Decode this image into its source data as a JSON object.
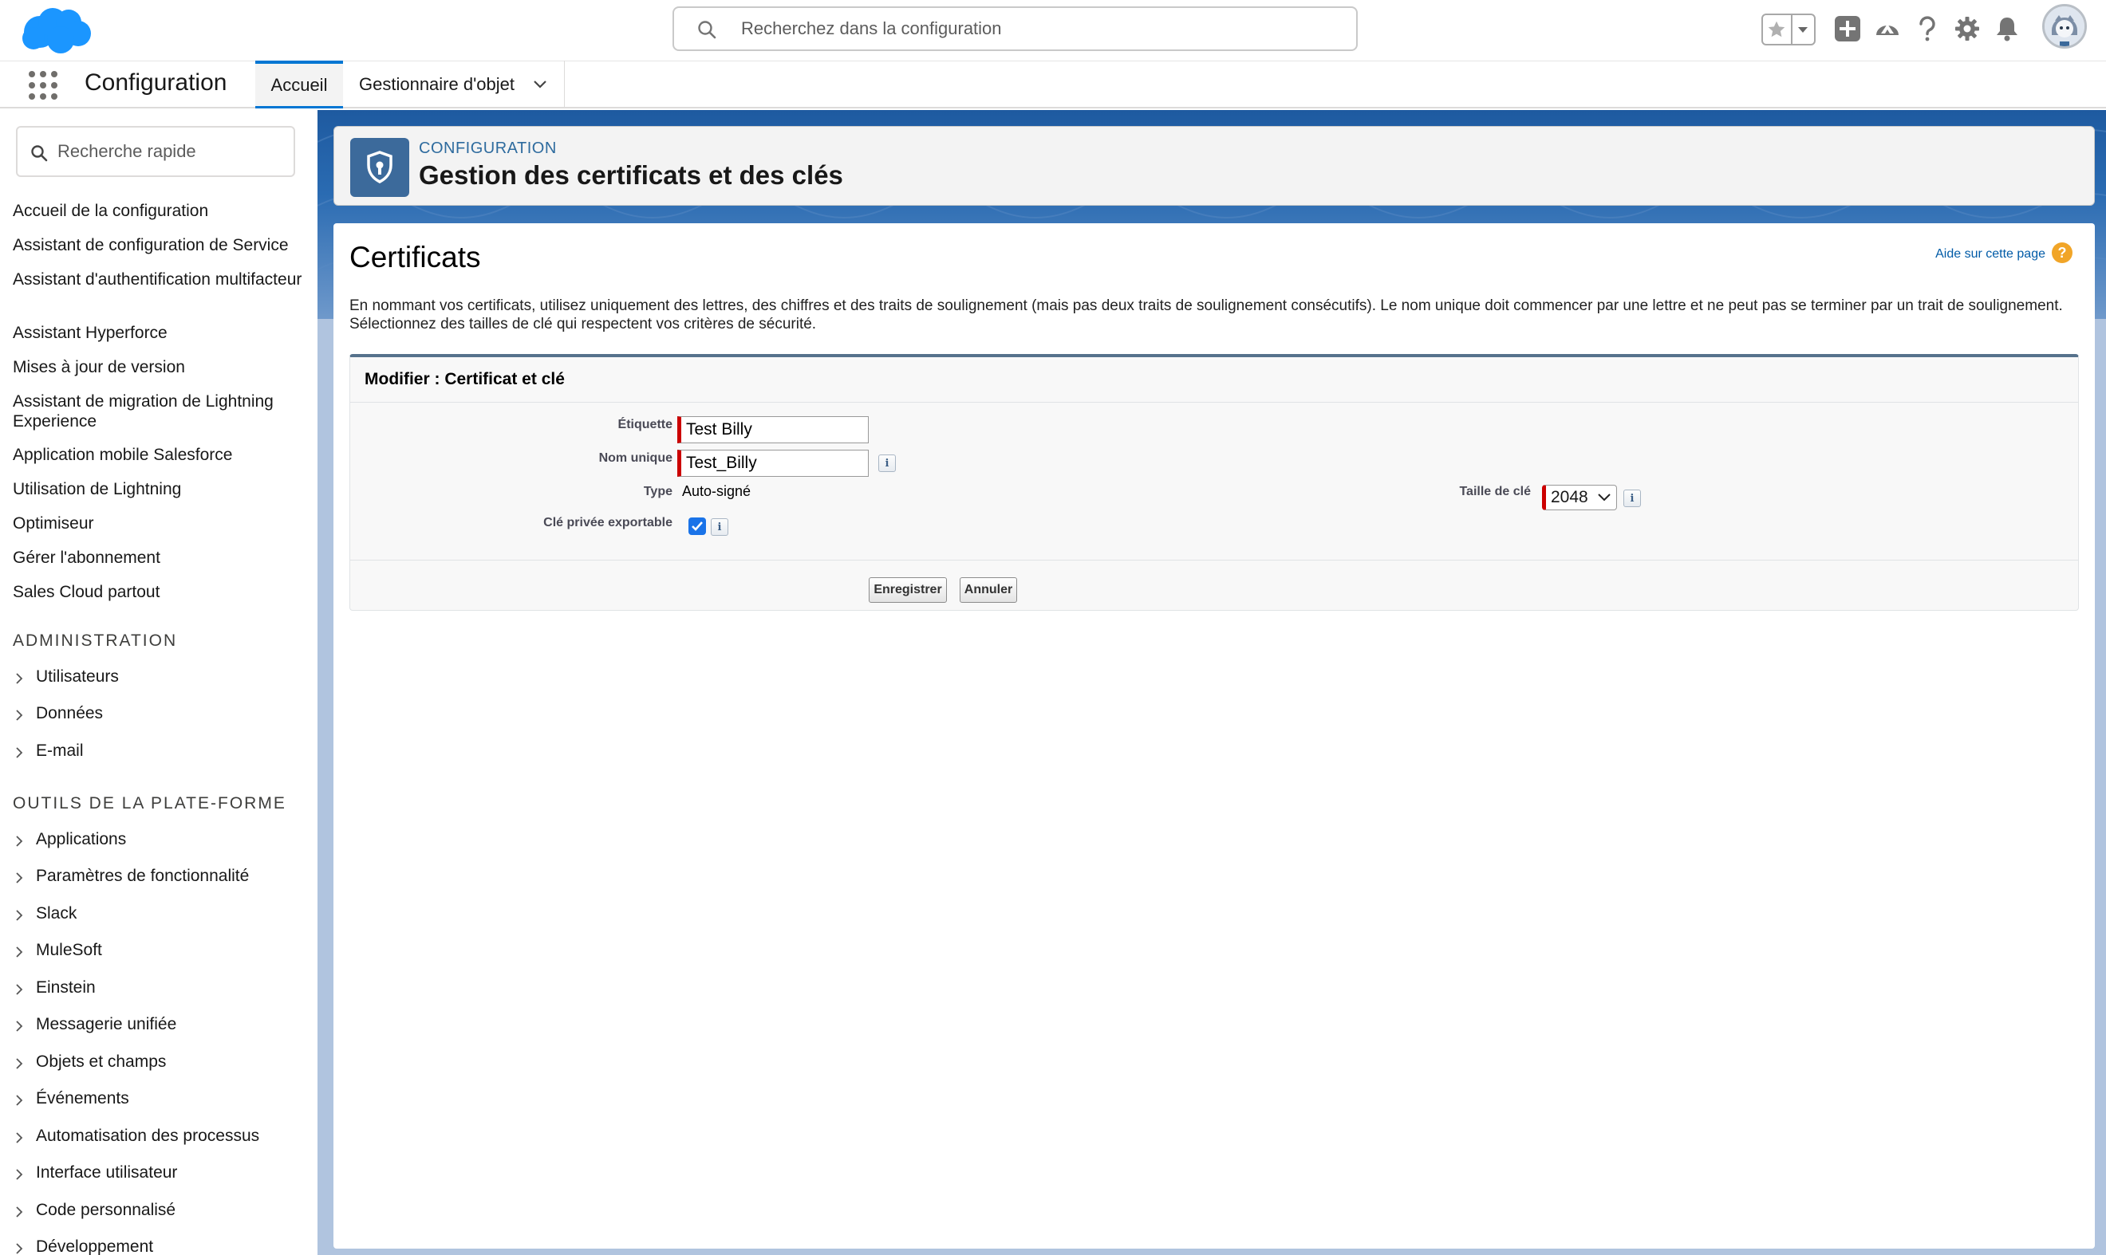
{
  "header": {
    "search_placeholder": "Recherchez dans la configuration",
    "icons": [
      "salesforce-logo",
      "favorite-star-icon",
      "favorite-dropdown-icon",
      "add-icon",
      "trailhead-icon",
      "help-icon",
      "setup-gear-icon",
      "notification-bell-icon",
      "user-avatar"
    ]
  },
  "app_bar": {
    "app_name": "Configuration",
    "tabs": [
      {
        "label": "Accueil",
        "active": true
      },
      {
        "label": "Gestionnaire d'objet",
        "active": false
      }
    ]
  },
  "sidebar": {
    "quick_find_placeholder": "Recherche rapide",
    "links": [
      "Accueil de la configuration",
      "Assistant de configuration de Service",
      "Assistant d'authentification multifacteur",
      "Assistant Hyperforce",
      "Mises à jour de version",
      "Assistant de migration de Lightning Experience",
      "Application mobile Salesforce",
      "Utilisation de Lightning",
      "Optimiseur",
      "Gérer l'abonnement",
      "Sales Cloud partout"
    ],
    "sections": [
      {
        "heading": "ADMINISTRATION",
        "items": [
          "Utilisateurs",
          "Données",
          "E-mail"
        ]
      },
      {
        "heading": "OUTILS DE LA PLATE-FORME",
        "items": [
          "Applications",
          "Paramètres de fonctionnalité",
          "Slack",
          "MuleSoft",
          "Einstein",
          "Messagerie unifiée",
          "Objets et champs",
          "Événements",
          "Automatisation des processus",
          "Interface utilisateur",
          "Code personnalisé",
          "Développement"
        ]
      }
    ]
  },
  "page_header": {
    "subtitle": "CONFIGURATION",
    "title": "Gestion des certificats et des clés"
  },
  "main": {
    "title": "Certificats",
    "help_link": "Aide sur cette page",
    "help_icon_glyph": "?",
    "intro": "En nommant vos certificats, utilisez uniquement des lettres, des chiffres et des traits de soulignement (mais pas deux traits de soulignement consécutifs). Le nom unique doit commencer par une lettre et ne peut pas se terminer par un trait de soulignement. Sélectionnez des tailles de clé qui respectent vos critères de sécurité.",
    "edit": {
      "title": "Modifier : Certificat et clé",
      "label_field": {
        "label": "Étiquette",
        "value": "Test Billy"
      },
      "unique_name_field": {
        "label": "Nom unique",
        "value": "Test_Billy"
      },
      "type_field": {
        "label": "Type",
        "value": "Auto-signé"
      },
      "key_size_field": {
        "label": "Taille de clé",
        "value": "2048"
      },
      "exportable_field": {
        "label": "Clé privée exportable",
        "checked": true
      },
      "info_glyph": "i",
      "save_label": "Enregistrer",
      "cancel_label": "Annuler"
    }
  },
  "colors": {
    "brand_blue": "#0176d3",
    "header_band": "#1e5aa0",
    "required_red": "#c00000",
    "help_orange": "#f1a528"
  }
}
